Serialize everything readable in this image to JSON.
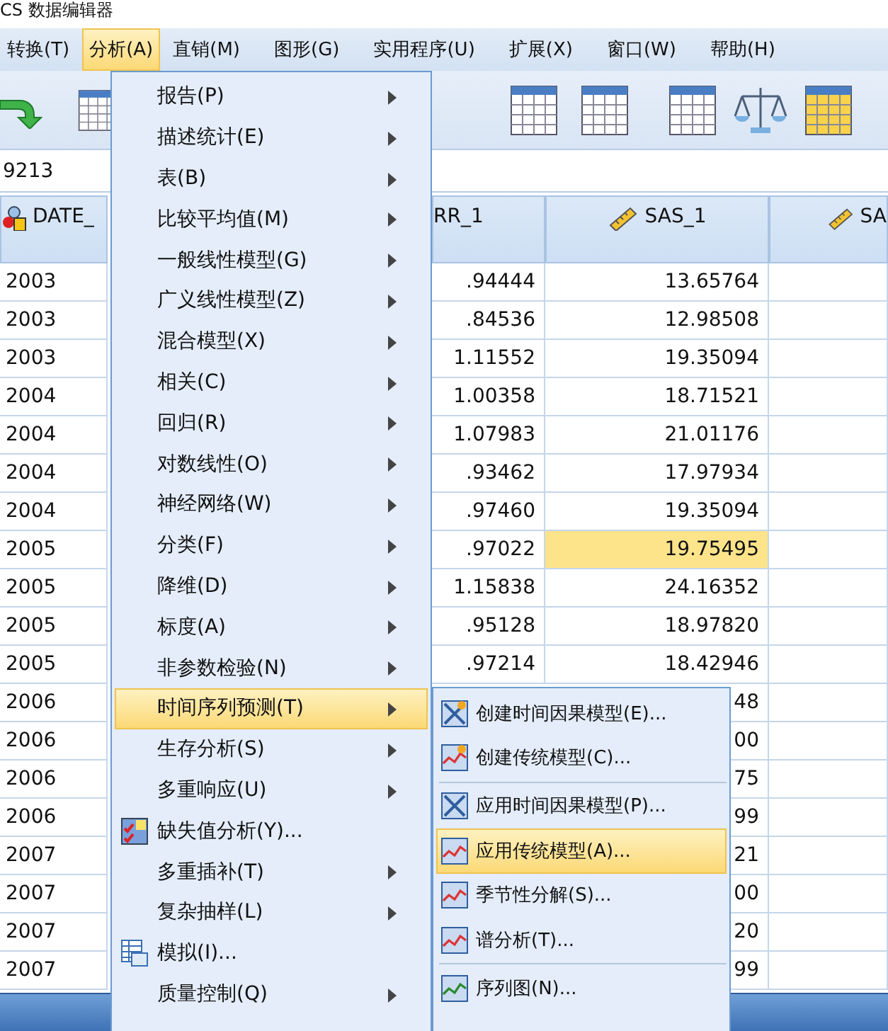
{
  "window": {
    "title": "CS 数据编辑器"
  },
  "menubar": [
    {
      "label": "转换(T)",
      "selected": false
    },
    {
      "label": "分析(A)",
      "selected": true
    },
    {
      "label": "直销(M)",
      "selected": false
    },
    {
      "label": "图形(G)",
      "selected": false
    },
    {
      "label": "实用程序(U)",
      "selected": false
    },
    {
      "label": "扩展(X)",
      "selected": false
    },
    {
      "label": "窗口(W)",
      "selected": false
    },
    {
      "label": "帮助(H)",
      "selected": false
    }
  ],
  "cell_editor": {
    "value": "9213"
  },
  "table": {
    "columns": [
      {
        "name": "DATE_",
        "kind": "nominal"
      },
      {
        "name": "RR_1"
      },
      {
        "name": "SAS_1",
        "kind": "scale"
      },
      {
        "name": "SA",
        "kind": "scale"
      }
    ],
    "rows": [
      {
        "date": "2003",
        "rr_1": ".94444",
        "sas_1": "13.65764",
        "selected": false
      },
      {
        "date": "2003",
        "rr_1": ".84536",
        "sas_1": "12.98508",
        "selected": false
      },
      {
        "date": "2003",
        "rr_1": "1.11552",
        "sas_1": "19.35094",
        "selected": false
      },
      {
        "date": "2004",
        "rr_1": "1.00358",
        "sas_1": "18.71521",
        "selected": false
      },
      {
        "date": "2004",
        "rr_1": "1.07983",
        "sas_1": "21.01176",
        "selected": false
      },
      {
        "date": "2004",
        "rr_1": ".93462",
        "sas_1": "17.97934",
        "selected": false
      },
      {
        "date": "2004",
        "rr_1": ".97460",
        "sas_1": "19.35094",
        "selected": false
      },
      {
        "date": "2005",
        "rr_1": ".97022",
        "sas_1": "19.75495",
        "selected": true
      },
      {
        "date": "2005",
        "rr_1": "1.15838",
        "sas_1": "24.16352",
        "selected": false
      },
      {
        "date": "2005",
        "rr_1": ".95128",
        "sas_1": "18.97820",
        "selected": false
      },
      {
        "date": "2005",
        "rr_1": ".97214",
        "sas_1": "18.42946",
        "selected": false
      },
      {
        "date": "2006",
        "sas_1": "48",
        "selected": false
      },
      {
        "date": "2006",
        "sas_1": "00",
        "selected": false
      },
      {
        "date": "2006",
        "sas_1": "75",
        "selected": false
      },
      {
        "date": "2006",
        "sas_1": "99",
        "selected": false
      },
      {
        "date": "2007",
        "sas_1": "21",
        "selected": false
      },
      {
        "date": "2007",
        "sas_1": "00",
        "selected": false
      },
      {
        "date": "2007",
        "sas_1": "20",
        "selected": false
      },
      {
        "date": "2007",
        "sas_1": "99",
        "selected": false
      }
    ]
  },
  "analyze_menu": [
    {
      "label": "报告(P)",
      "kind": "submenu",
      "selected": false
    },
    {
      "label": "描述统计(E)",
      "kind": "submenu",
      "selected": false
    },
    {
      "label": "表(B)",
      "kind": "submenu",
      "selected": false
    },
    {
      "label": "比较平均值(M)",
      "kind": "submenu",
      "selected": false
    },
    {
      "label": "一般线性模型(G)",
      "kind": "submenu",
      "selected": false
    },
    {
      "label": "广义线性模型(Z)",
      "kind": "submenu",
      "selected": false
    },
    {
      "label": "混合模型(X)",
      "kind": "submenu",
      "selected": false
    },
    {
      "label": "相关(C)",
      "kind": "submenu",
      "selected": false
    },
    {
      "label": "回归(R)",
      "kind": "submenu",
      "selected": false
    },
    {
      "label": "对数线性(O)",
      "kind": "submenu",
      "selected": false
    },
    {
      "label": "神经网络(W)",
      "kind": "submenu",
      "selected": false
    },
    {
      "label": "分类(F)",
      "kind": "submenu",
      "selected": false
    },
    {
      "label": "降维(D)",
      "kind": "submenu",
      "selected": false
    },
    {
      "label": "标度(A)",
      "kind": "submenu",
      "selected": false
    },
    {
      "label": "非参数检验(N)",
      "kind": "submenu",
      "selected": false
    },
    {
      "label": "时间序列预测(T)",
      "kind": "submenu",
      "selected": true
    },
    {
      "label": "生存分析(S)",
      "kind": "submenu",
      "selected": false
    },
    {
      "label": "多重响应(U)",
      "kind": "submenu",
      "selected": false
    },
    {
      "label": "缺失值分析(Y)...",
      "kind": "dialog",
      "selected": false
    },
    {
      "label": "多重插补(T)",
      "kind": "submenu",
      "selected": false
    },
    {
      "label": "复杂抽样(L)",
      "kind": "submenu",
      "selected": false
    },
    {
      "label": "模拟(I)...",
      "kind": "dialog",
      "selected": false
    },
    {
      "label": "质量控制(Q)",
      "kind": "submenu",
      "selected": false
    }
  ],
  "time_series_submenu": [
    [
      {
        "label": "创建时间因果模型(E)...",
        "selected": false
      },
      {
        "label": "创建传统模型(C)...",
        "selected": false
      }
    ],
    [
      {
        "label": "应用时间因果模型(P)...",
        "selected": false
      },
      {
        "label": "应用传统模型(A)...",
        "selected": true
      },
      {
        "label": "季节性分解(S)...",
        "selected": false
      },
      {
        "label": "谱分析(T)...",
        "selected": false
      }
    ],
    [
      {
        "label": "序列图(N)...",
        "selected": false
      }
    ]
  ]
}
